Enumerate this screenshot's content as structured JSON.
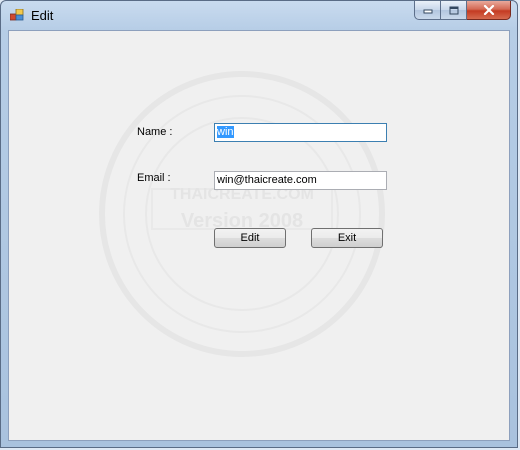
{
  "window": {
    "title": "Edit",
    "controls": {
      "minimize_icon": "minimize-icon",
      "maximize_icon": "maximize-icon",
      "close_icon": "close-icon"
    }
  },
  "form": {
    "name_label": "Name :",
    "name_value": "win",
    "email_label": "Email :",
    "email_value": "win@thaicreate.com",
    "edit_button": "Edit",
    "exit_button": "Exit"
  },
  "colors": {
    "selection": "#3399ff",
    "client_bg": "#f0f0f0",
    "close_button": "#c43b22"
  }
}
